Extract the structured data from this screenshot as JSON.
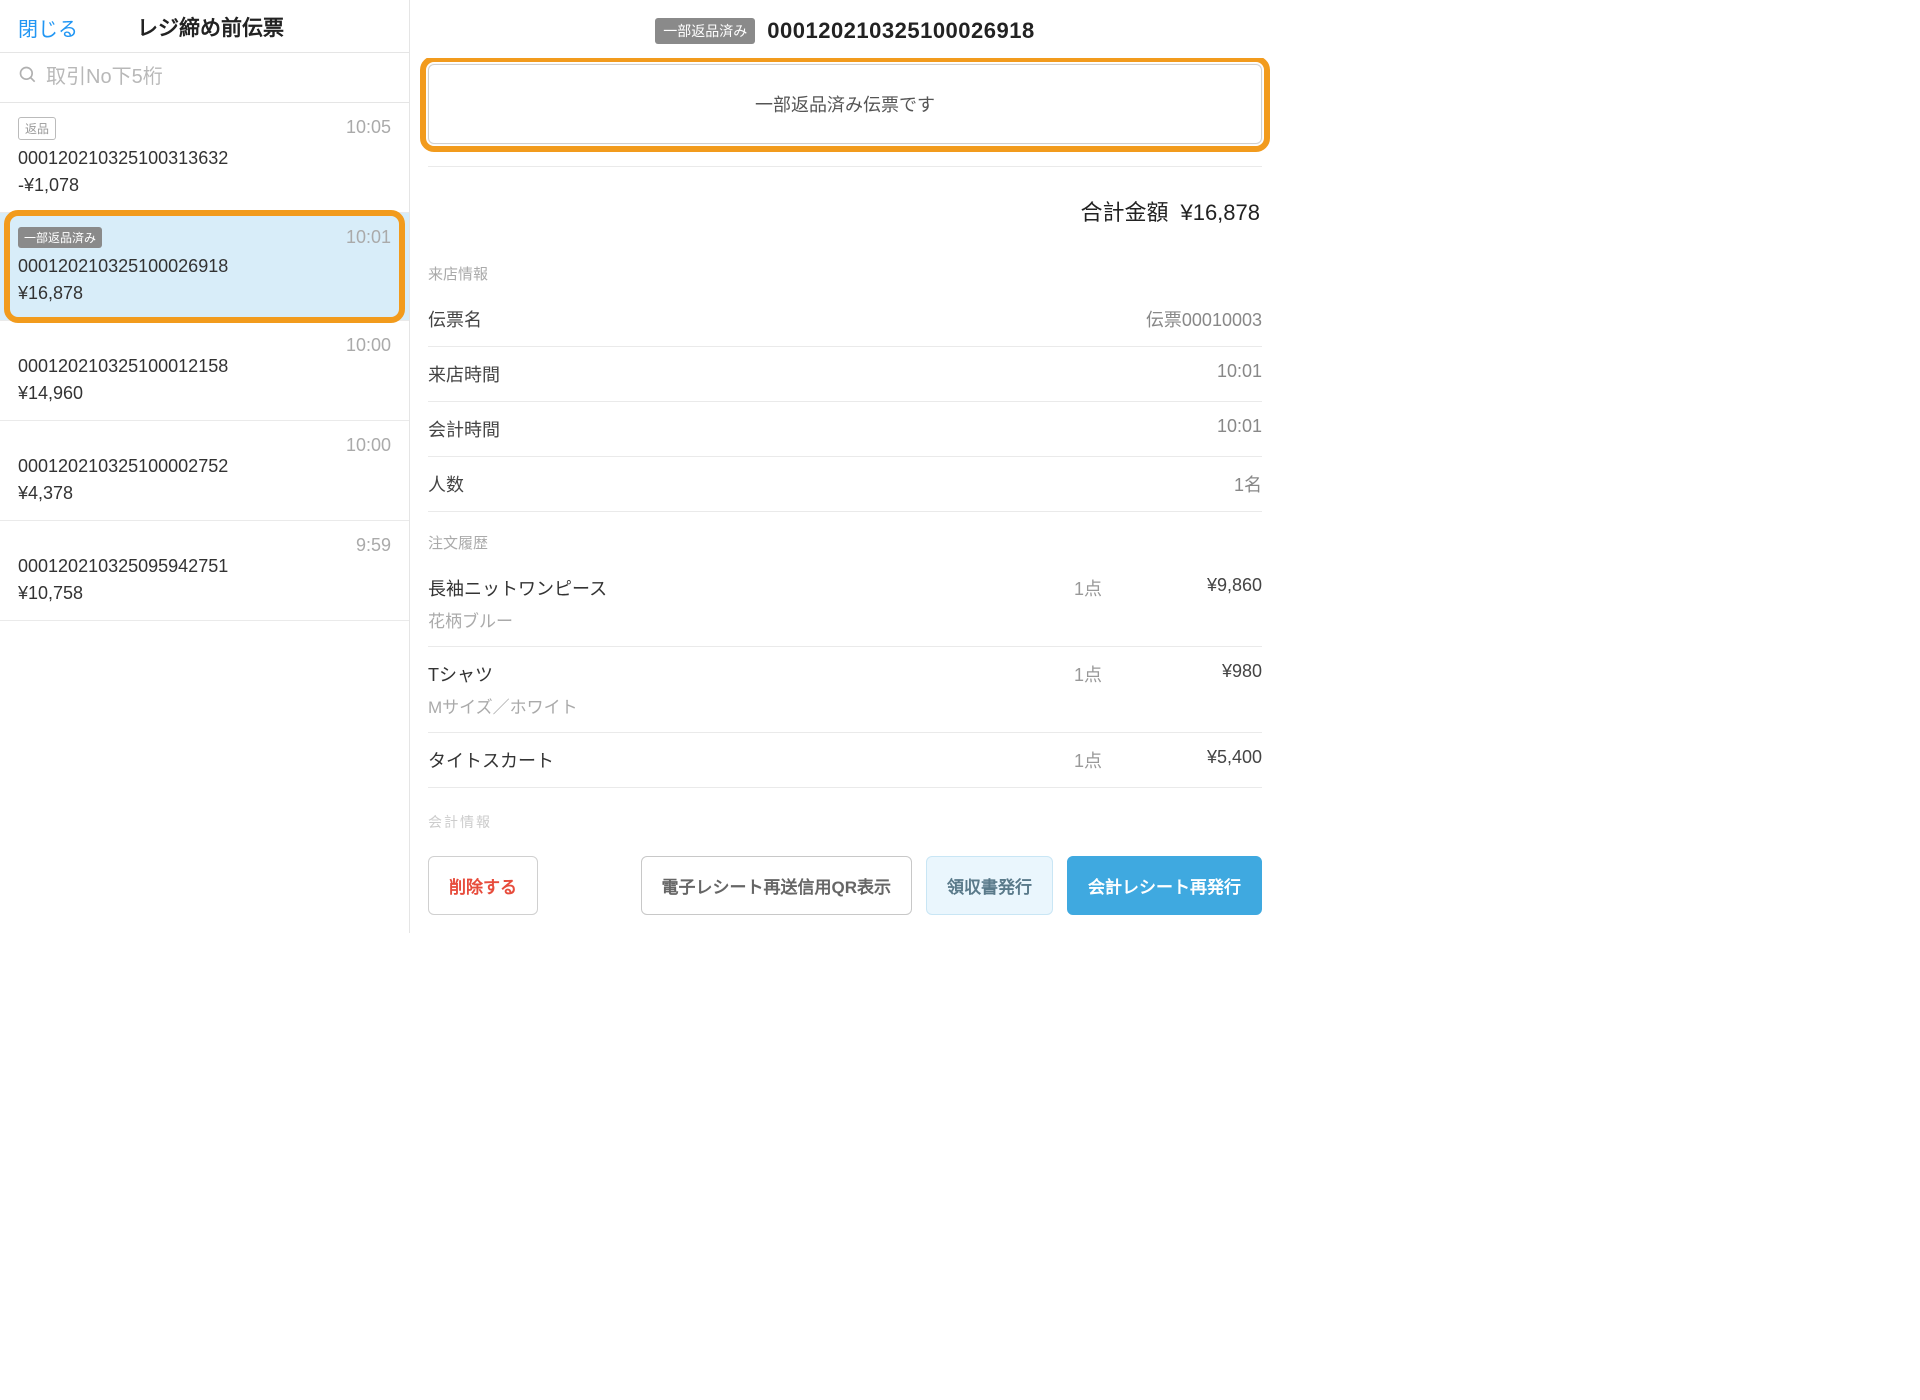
{
  "sidebar": {
    "close_label": "閉じる",
    "title": "レジ締め前伝票",
    "search_placeholder": "取引No下5桁",
    "items": [
      {
        "badge_text": "返品",
        "badge_style": "outline",
        "time": "10:05",
        "no": "000120210325100313632",
        "amount": "-¥1,078",
        "selected": false
      },
      {
        "badge_text": "一部返品済み",
        "badge_style": "fill",
        "time": "10:01",
        "no": "000120210325100026918",
        "amount": "¥16,878",
        "selected": true,
        "highlight": true
      },
      {
        "time": "10:00",
        "no": "000120210325100012158",
        "amount": "¥14,960",
        "selected": false
      },
      {
        "time": "10:00",
        "no": "000120210325100002752",
        "amount": "¥4,378",
        "selected": false
      },
      {
        "time": "9:59",
        "no": "000120210325095942751",
        "amount": "¥10,758",
        "selected": false
      }
    ]
  },
  "detail": {
    "header_badge": "一部返品済み",
    "header_no": "000120210325100026918",
    "notice": "一部返品済み伝票です",
    "total_label": "合計金額",
    "total_value": "¥16,878",
    "visit_section": "来店情報",
    "visit_rows": [
      {
        "k": "伝票名",
        "v": "伝票00010003"
      },
      {
        "k": "来店時間",
        "v": "10:01"
      },
      {
        "k": "会計時間",
        "v": "10:01"
      },
      {
        "k": "人数",
        "v": "1名"
      }
    ],
    "order_section": "注文履歴",
    "orders": [
      {
        "name": "長袖ニットワンピース",
        "sub": "花柄ブルー",
        "qty": "1点",
        "price": "¥9,860"
      },
      {
        "name": "Tシャツ",
        "sub": "Mサイズ／ホワイト",
        "qty": "1点",
        "price": "¥980"
      },
      {
        "name": "タイトスカート",
        "sub": "",
        "qty": "1点",
        "price": "¥5,400"
      }
    ],
    "cutoff_hint": "会計情報"
  },
  "footer": {
    "delete": "削除する",
    "qr": "電子レシート再送信用QR表示",
    "receipt": "領収書発行",
    "reprint": "会計レシート再発行"
  }
}
